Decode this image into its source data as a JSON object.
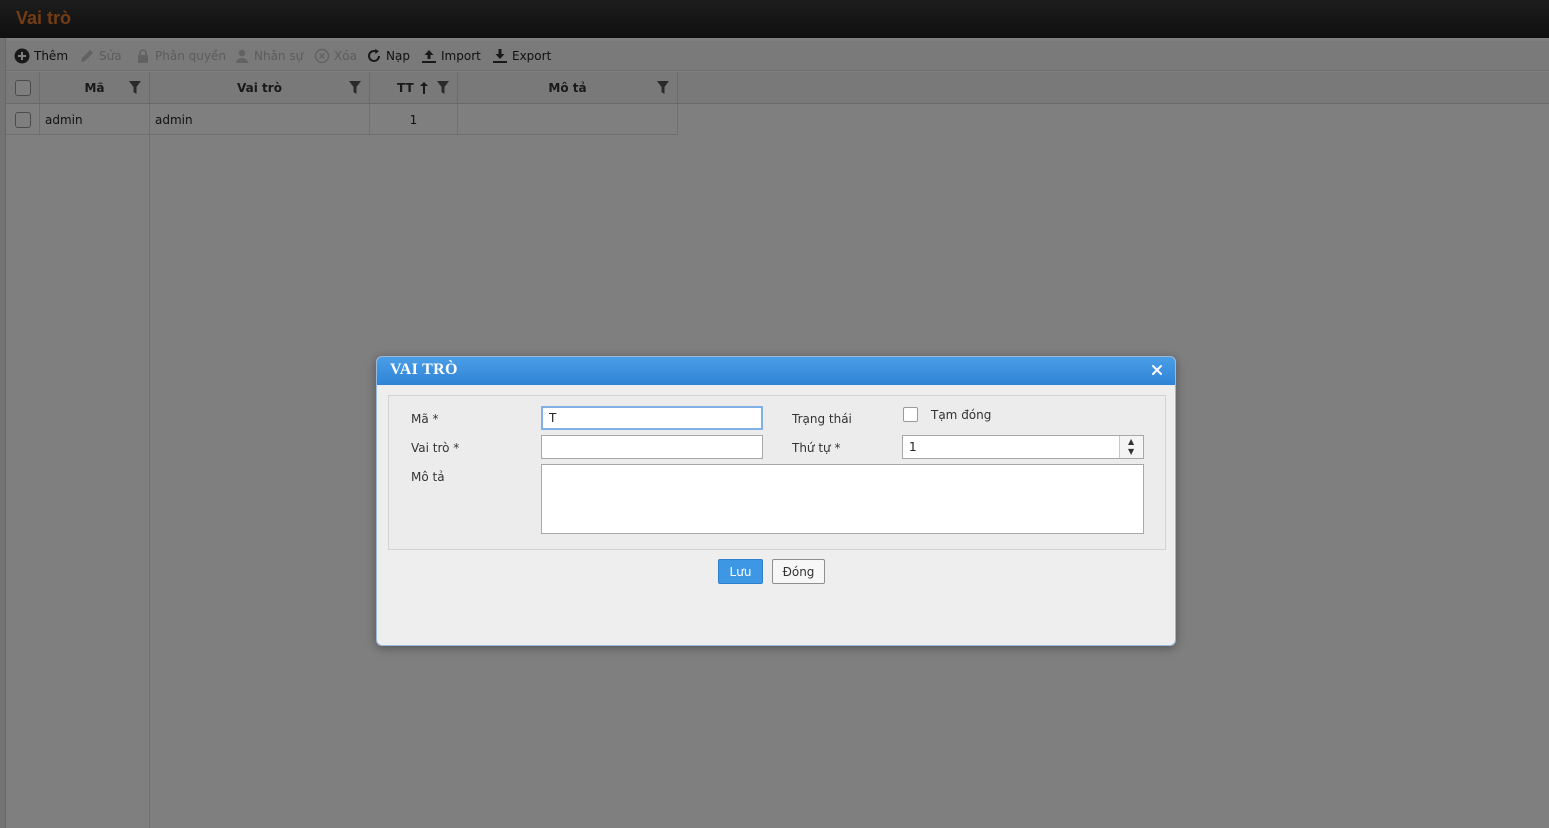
{
  "page": {
    "title": "Vai trò"
  },
  "toolbar": {
    "add_label": "Thêm",
    "edit_label": "Sửa",
    "permission_label": "Phân quyền",
    "staff_label": "Nhân sự",
    "delete_label": "Xóa",
    "reload_label": "Nạp",
    "import_label": "Import",
    "export_label": "Export"
  },
  "grid": {
    "columns": [
      "Mã",
      "Vai trò",
      "TT",
      "Mô tả"
    ],
    "rows": [
      {
        "code": "admin",
        "role": "admin",
        "order": "1",
        "description": ""
      }
    ]
  },
  "dialog": {
    "title": "VAI TRÒ",
    "fields": {
      "code_label": "Mã *",
      "code_value": "T",
      "role_label": "Vai trò *",
      "role_value": "",
      "description_label": "Mô tả",
      "description_value": "",
      "status_label": "Trạng thái",
      "status_option_label": "Tạm đóng",
      "order_label": "Thứ tự *",
      "order_value": "1"
    },
    "save_label": "Lưu",
    "close_label": "Đóng"
  },
  "colors": {
    "title_accent": "#e8792a",
    "dialog_header": "#3a90de",
    "primary_button": "#3e97e5"
  }
}
